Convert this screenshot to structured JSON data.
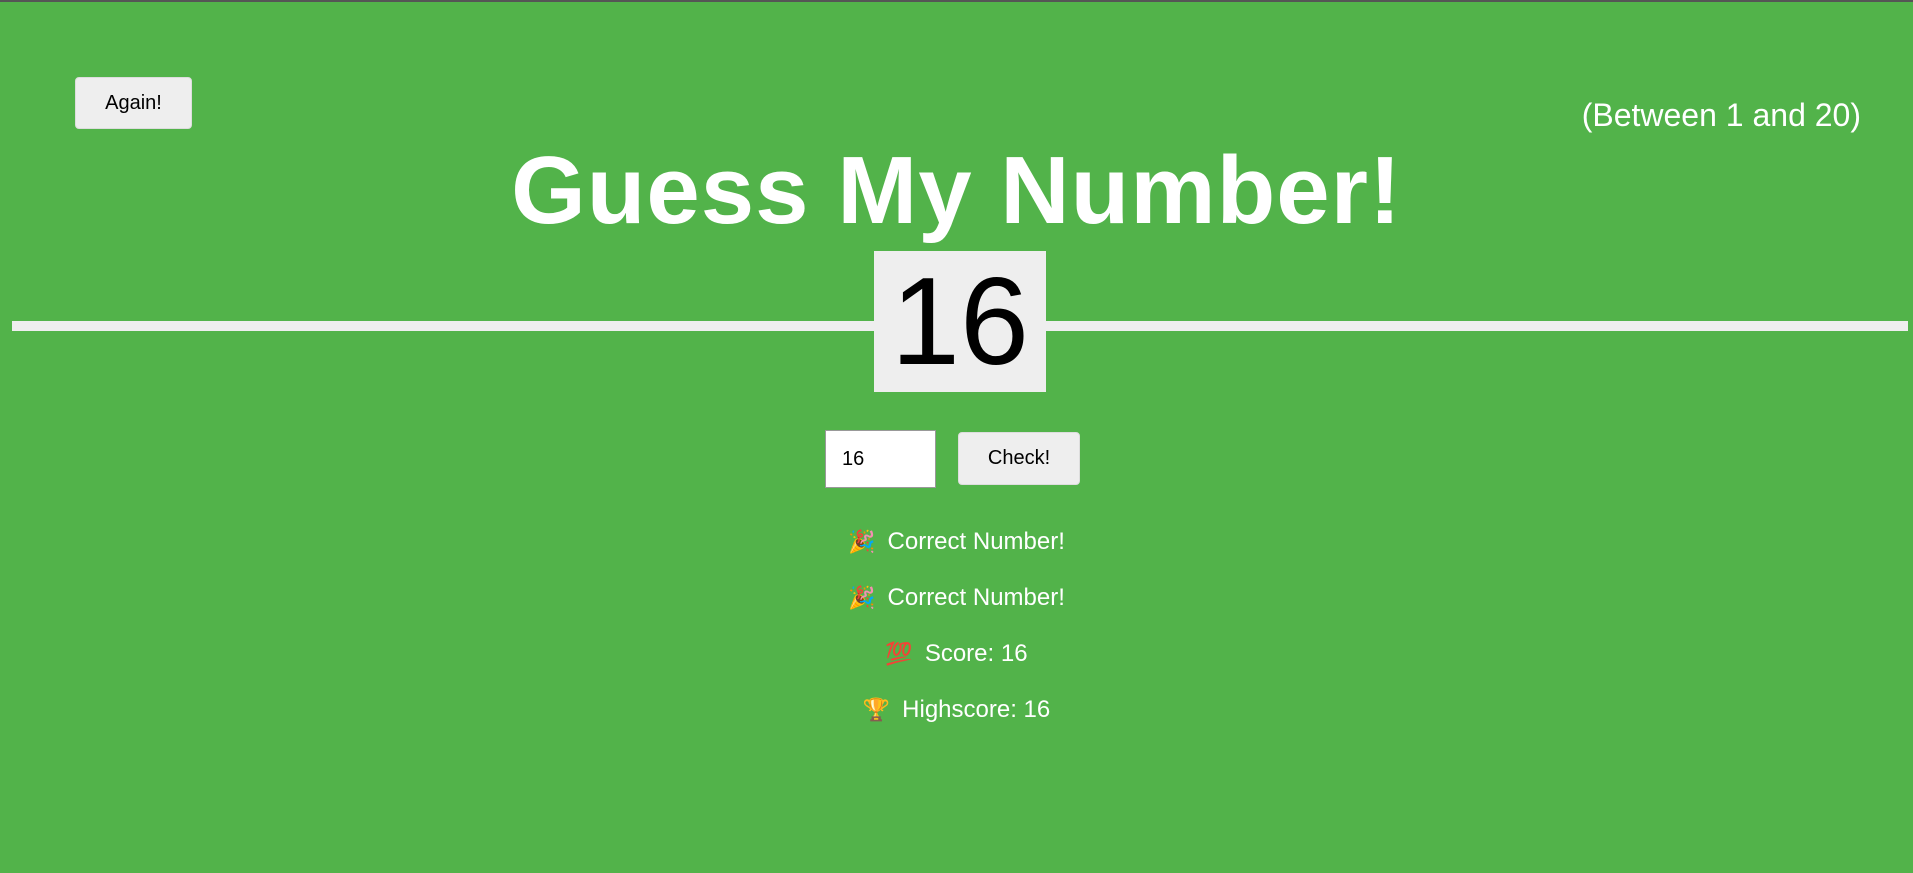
{
  "controls": {
    "again_label": "Again!",
    "check_label": "Check!",
    "guess_value": "16"
  },
  "header": {
    "range_hint": "(Between 1 and 20)",
    "title": "Guess My Number!"
  },
  "secret_number": "16",
  "messages": {
    "message_1": {
      "icon": "🎉",
      "text": "Correct Number!"
    },
    "message_2": {
      "icon": "🎉",
      "text": "Correct Number!"
    },
    "score": {
      "icon": "💯",
      "text": "Score: 16"
    },
    "highscore": {
      "icon": "🏆",
      "text": "Highscore: 16"
    }
  },
  "colors": {
    "background": "#52b34a",
    "panel": "#eeeeee"
  }
}
